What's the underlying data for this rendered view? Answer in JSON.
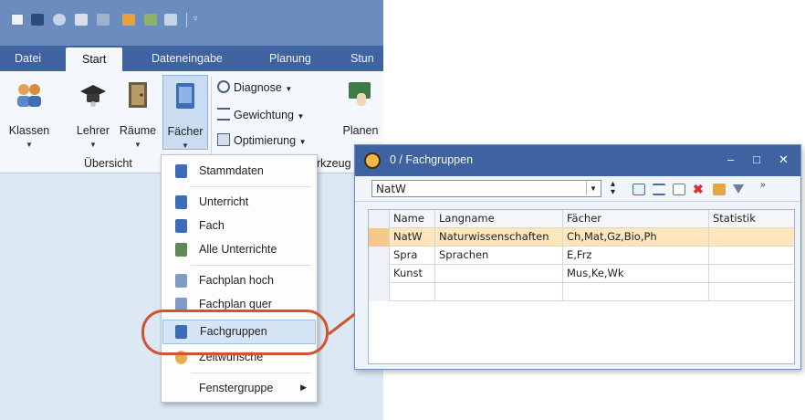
{
  "ribbon": {
    "tabs": [
      "Datei",
      "Start",
      "Dateneingabe",
      "Planung",
      "Stun"
    ],
    "active_tab": "Start",
    "big_buttons": [
      "Klassen",
      "Lehrer",
      "Räume",
      "Fächer"
    ],
    "small_buttons": [
      "Diagnose",
      "Gewichtung",
      "Optimierung"
    ],
    "planen_label": "Planen",
    "group_overview": "Übersicht",
    "group_tools_partial": "rkzeug"
  },
  "menu": {
    "items": [
      "Stammdaten",
      "Unterricht",
      "Fach",
      "Alle Unterrichte",
      "Fachplan hoch",
      "Fachplan quer",
      "Fachgruppen",
      "Zeitwünsche",
      "Fenstergruppe"
    ],
    "highlighted": "Fachgruppen"
  },
  "window": {
    "title": "0 / Fachgruppen",
    "combo_value": "NatW",
    "columns": [
      "Name",
      "Langname",
      "Fächer",
      "Statistik"
    ],
    "rows": [
      {
        "name": "NatW",
        "langname": "Naturwissenschaften",
        "faecher": "Ch,Mat,Gz,Bio,Ph",
        "statistik": ""
      },
      {
        "name": "Spra",
        "langname": "Sprachen",
        "faecher": "E,Frz",
        "statistik": ""
      },
      {
        "name": "Kunst",
        "langname": "",
        "faecher": "Mus,Ke,Wk",
        "statistik": ""
      }
    ]
  },
  "colors": {
    "title_bar": "#3f62a0",
    "highlight_ring": "#d2532f",
    "selected_row": "#ffe6bf"
  }
}
